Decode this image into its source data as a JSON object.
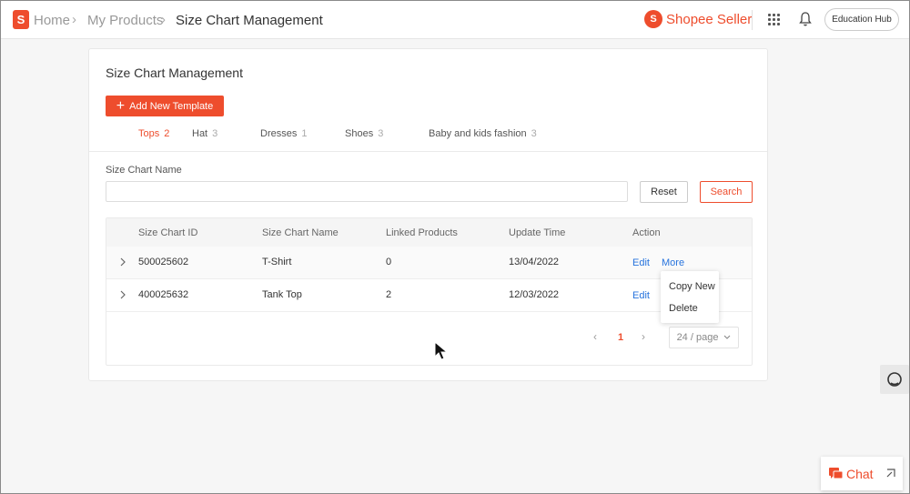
{
  "breadcrumb": {
    "home": "Home",
    "products": "My Products",
    "current": "Size Chart Management"
  },
  "header": {
    "brand": "Shopee Seller",
    "education_hub": "Education Hub"
  },
  "page": {
    "title": "Size Chart Management",
    "add_button": "Add New Template",
    "field_label": "Size Chart Name",
    "input_value": "",
    "reset": "Reset",
    "search": "Search"
  },
  "tabs": [
    {
      "label": "Tops",
      "count": "2"
    },
    {
      "label": "Hat",
      "count": "3"
    },
    {
      "label": "Dresses",
      "count": "1"
    },
    {
      "label": "Shoes",
      "count": "3"
    },
    {
      "label": "Baby and kids fashion",
      "count": "3"
    }
  ],
  "table": {
    "headers": [
      "Size Chart ID",
      "Size Chart Name",
      "Linked Products",
      "Update Time",
      "Action"
    ],
    "rows": [
      {
        "id": "500025602",
        "name": "T-Shirt",
        "linked": "0",
        "updated": "13/04/2022",
        "edit": "Edit",
        "more": "More"
      },
      {
        "id": "400025632",
        "name": "Tank Top",
        "linked": "2",
        "updated": "12/03/2022",
        "edit": "Edit"
      }
    ]
  },
  "menu": {
    "copy": "Copy New",
    "delete": "Delete"
  },
  "pagination": {
    "current": "1",
    "per_page": "24 / page"
  },
  "chat": {
    "label": "Chat"
  },
  "colors": {
    "accent": "#ee4d2d",
    "link": "#2673dd"
  }
}
